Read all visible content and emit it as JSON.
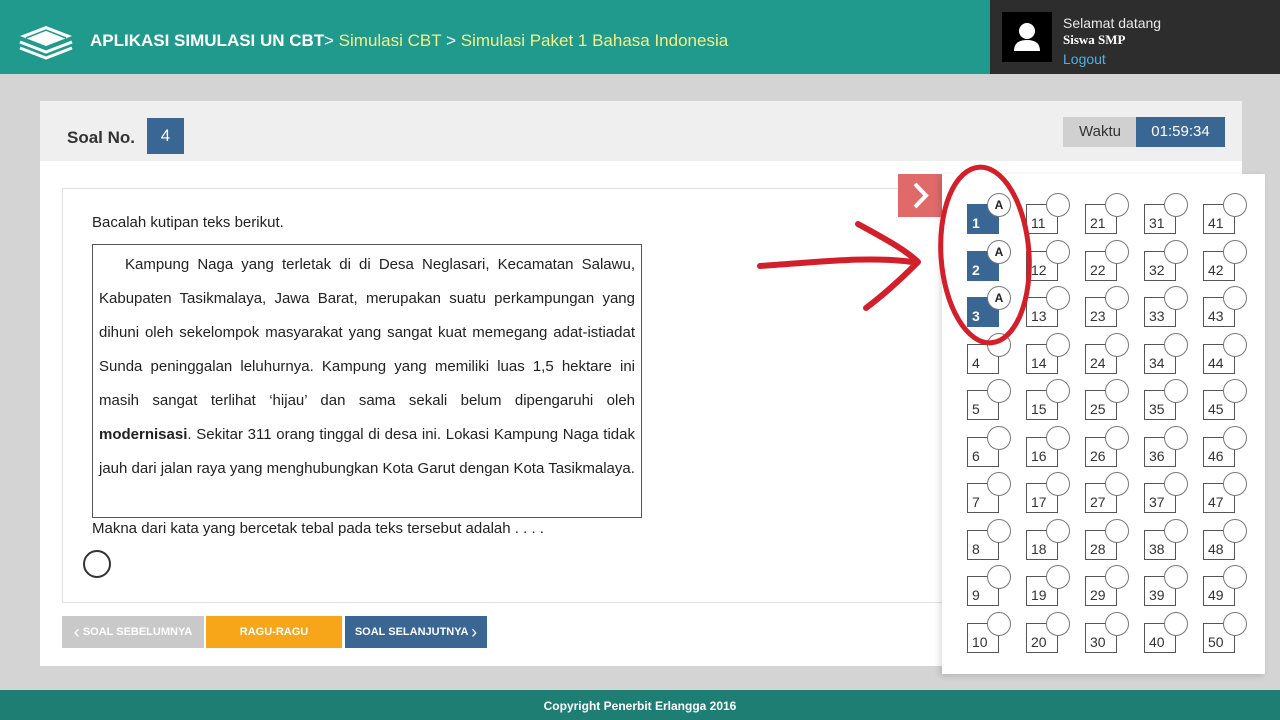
{
  "header": {
    "app_title": "APLIKASI SIMULASI UN CBT",
    "sep1": ">",
    "crumb1": "Simulasi CBT",
    "sep2": ">",
    "crumb2": "Simulasi Paket 1 Bahasa Indonesia",
    "welcome": "Selamat datang",
    "username": "Siswa SMP",
    "logout": "Logout"
  },
  "soal": {
    "label": "Soal No.",
    "number": "4",
    "waktu_label": "Waktu",
    "waktu_value": "01:59:34"
  },
  "content": {
    "instruction": "Bacalah kutipan teks berikut.",
    "passage_before": "Kampung Naga yang terletak di di Desa Neglasari, Kecamatan Salawu, Kabupaten Tasikmalaya, Jawa Barat, merupakan suatu perkampungan yang dihuni oleh sekelompok masyarakat yang sangat kuat memegang adat-istiadat Sunda peninggalan leluhurnya. Kampung yang memiliki luas 1,5 hektare ini masih sangat terlihat ‘hijau’ dan sama sekali belum dipengaruhi oleh ",
    "passage_bold": "modernisasi",
    "passage_after": ". Sekitar 311 orang tinggal di desa ini. Lokasi Kampung Naga tidak jauh dari jalan raya yang menghubungkan Kota Garut dengan Kota Tasikmalaya.",
    "question": "Makna dari kata yang bercetak tebal pada teks tersebut adalah . . . ."
  },
  "buttons": {
    "prev": "SOAL SEBELUMNYA",
    "ragu": "RAGU-RAGU",
    "next": "SOAL SELANJUTNYA"
  },
  "nav": {
    "questions": [
      {
        "n": "1",
        "answer": "A",
        "answered": true
      },
      {
        "n": "2",
        "answer": "A",
        "answered": true
      },
      {
        "n": "3",
        "answer": "A",
        "answered": true
      },
      {
        "n": "4",
        "answer": "",
        "answered": false
      },
      {
        "n": "5",
        "answer": "",
        "answered": false
      },
      {
        "n": "6",
        "answer": "",
        "answered": false
      },
      {
        "n": "7",
        "answer": "",
        "answered": false
      },
      {
        "n": "8",
        "answer": "",
        "answered": false
      },
      {
        "n": "9",
        "answer": "",
        "answered": false
      },
      {
        "n": "10",
        "answer": "",
        "answered": false
      },
      {
        "n": "11",
        "answer": "",
        "answered": false
      },
      {
        "n": "12",
        "answer": "",
        "answered": false
      },
      {
        "n": "13",
        "answer": "",
        "answered": false
      },
      {
        "n": "14",
        "answer": "",
        "answered": false
      },
      {
        "n": "15",
        "answer": "",
        "answered": false
      },
      {
        "n": "16",
        "answer": "",
        "answered": false
      },
      {
        "n": "17",
        "answer": "",
        "answered": false
      },
      {
        "n": "18",
        "answer": "",
        "answered": false
      },
      {
        "n": "19",
        "answer": "",
        "answered": false
      },
      {
        "n": "20",
        "answer": "",
        "answered": false
      },
      {
        "n": "21",
        "answer": "",
        "answered": false
      },
      {
        "n": "22",
        "answer": "",
        "answered": false
      },
      {
        "n": "23",
        "answer": "",
        "answered": false
      },
      {
        "n": "24",
        "answer": "",
        "answered": false
      },
      {
        "n": "25",
        "answer": "",
        "answered": false
      },
      {
        "n": "26",
        "answer": "",
        "answered": false
      },
      {
        "n": "27",
        "answer": "",
        "answered": false
      },
      {
        "n": "28",
        "answer": "",
        "answered": false
      },
      {
        "n": "29",
        "answer": "",
        "answered": false
      },
      {
        "n": "30",
        "answer": "",
        "answered": false
      },
      {
        "n": "31",
        "answer": "",
        "answered": false
      },
      {
        "n": "32",
        "answer": "",
        "answered": false
      },
      {
        "n": "33",
        "answer": "",
        "answered": false
      },
      {
        "n": "34",
        "answer": "",
        "answered": false
      },
      {
        "n": "35",
        "answer": "",
        "answered": false
      },
      {
        "n": "36",
        "answer": "",
        "answered": false
      },
      {
        "n": "37",
        "answer": "",
        "answered": false
      },
      {
        "n": "38",
        "answer": "",
        "answered": false
      },
      {
        "n": "39",
        "answer": "",
        "answered": false
      },
      {
        "n": "40",
        "answer": "",
        "answered": false
      },
      {
        "n": "41",
        "answer": "",
        "answered": false
      },
      {
        "n": "42",
        "answer": "",
        "answered": false
      },
      {
        "n": "43",
        "answer": "",
        "answered": false
      },
      {
        "n": "44",
        "answer": "",
        "answered": false
      },
      {
        "n": "45",
        "answer": "",
        "answered": false
      },
      {
        "n": "46",
        "answer": "",
        "answered": false
      },
      {
        "n": "47",
        "answer": "",
        "answered": false
      },
      {
        "n": "48",
        "answer": "",
        "answered": false
      },
      {
        "n": "49",
        "answer": "",
        "answered": false
      },
      {
        "n": "50",
        "answer": "",
        "answered": false
      }
    ]
  },
  "footer": {
    "copyright": "Copyright Penerbit Erlangga 2016"
  },
  "colors": {
    "header": "#1f9a8d",
    "primary": "#3a6694",
    "ragu": "#f6a618",
    "toggle": "#e06a6a",
    "footer": "#1f7e73"
  }
}
